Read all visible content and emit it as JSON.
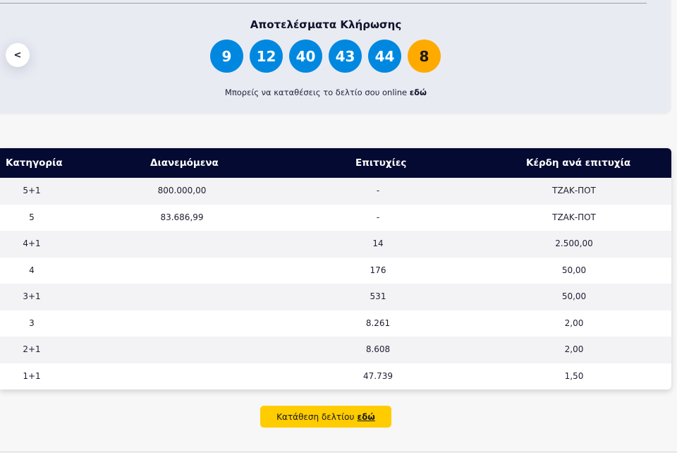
{
  "header": {
    "title": "Αποτελέσματα Κλήρωσης",
    "prev_icon": "chevron-left-icon"
  },
  "numbers": {
    "main": [
      "9",
      "12",
      "40",
      "43",
      "44"
    ],
    "bonus": "8",
    "colors": {
      "main": "#0088e0",
      "bonus": "#ffaa00"
    }
  },
  "online_note": {
    "text": "Μπορείς να καταθέσεις το δελτίο σου online ",
    "link": "εδώ"
  },
  "table": {
    "headers": [
      "Κατηγορία",
      "Διανεμόμενα",
      "Επιτυχίες",
      "Κέρδη ανά επιτυχία"
    ],
    "rows": [
      [
        "5+1",
        "800.000,00",
        "-",
        "ΤΖΑΚ-ΠΟΤ"
      ],
      [
        "5",
        "83.686,99",
        "-",
        "ΤΖΑΚ-ΠΟΤ"
      ],
      [
        "4+1",
        "",
        "14",
        "2.500,00"
      ],
      [
        "4",
        "",
        "176",
        "50,00"
      ],
      [
        "3+1",
        "",
        "531",
        "50,00"
      ],
      [
        "3",
        "",
        "8.261",
        "2,00"
      ],
      [
        "2+1",
        "",
        "8.608",
        "2,00"
      ],
      [
        "1+1",
        "",
        "47.739",
        "1,50"
      ]
    ],
    "header_color": "#050a32"
  },
  "submit_button": {
    "text": "Κατάθεση δελτίου",
    "link": "εδώ",
    "color": "#ffcc00"
  }
}
